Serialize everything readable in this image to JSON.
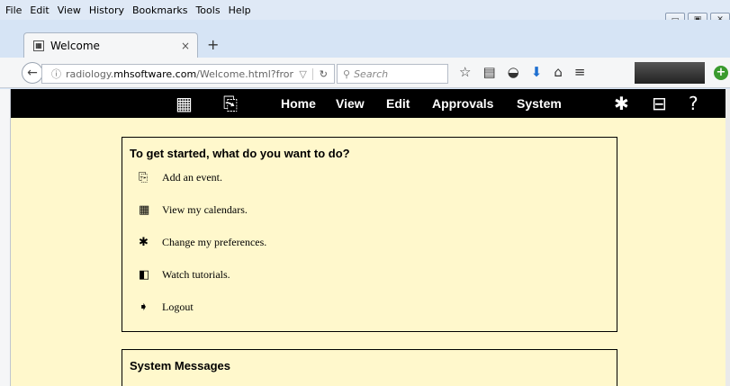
{
  "menu": [
    "File",
    "Edit",
    "View",
    "History",
    "Bookmarks",
    "Tools",
    "Help"
  ],
  "tab": {
    "title": "Welcome",
    "close": "×",
    "new": "+"
  },
  "url": {
    "host_prefix": "radiology.",
    "host": "mhsoftware.com",
    "path": "/Welcome.html?from_l"
  },
  "search": {
    "placeholder": "Search"
  },
  "appnav": {
    "icons": [
      "calendar-icon",
      "add-event-icon"
    ],
    "items": [
      "Home",
      "View",
      "Edit",
      "Approvals",
      "System"
    ],
    "right_icons": [
      "gear-icon",
      "briefcase-icon",
      "help-icon"
    ]
  },
  "getstarted": {
    "title": "To get started, what do you want to do?",
    "options": [
      {
        "icon": "add-event-icon",
        "glyph": "⎘",
        "label": "Add an event."
      },
      {
        "icon": "calendar-icon",
        "glyph": "▦",
        "label": "View my calendars."
      },
      {
        "icon": "gear-icon",
        "glyph": "✱",
        "label": "Change my preferences."
      },
      {
        "icon": "film-icon",
        "glyph": "◧",
        "label": "Watch tutorials."
      },
      {
        "icon": "logout-icon",
        "glyph": "➧",
        "label": "Logout"
      }
    ]
  },
  "messages": {
    "title": "System Messages"
  },
  "colors": {
    "content_bg": "#fff8cc",
    "nav_bg": "#000000"
  }
}
